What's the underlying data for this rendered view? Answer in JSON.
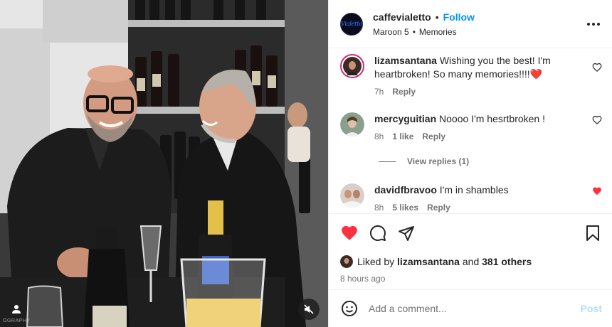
{
  "header": {
    "username": "caffevialetto",
    "separator": "•",
    "follow_label": "Follow",
    "audio_artist": "Maroon 5",
    "audio_separator": "•",
    "audio_track": "Memories",
    "logo_text": "Vialetto",
    "more_icon": "more-horizontal-icon"
  },
  "media": {
    "watermark": "OGRAPHY",
    "user_tag_icon": "user-tag-icon",
    "mute_icon": "speaker-muted-icon"
  },
  "comments": [
    {
      "username": "lizamsantana",
      "text": "Wishing you the best! I'm heartbroken! So many memories!!!!❤️",
      "time": "7h",
      "likes": "",
      "reply_label": "Reply",
      "liked": false
    },
    {
      "username": "mercyguitian",
      "text": "Noooo I'm hesrtbroken !",
      "time": "8h",
      "likes": "1 like",
      "reply_label": "Reply",
      "liked": false
    },
    {
      "username": "davidfbravoo",
      "text": "I'm in shambles",
      "time": "8h",
      "likes": "5 likes",
      "reply_label": "Reply",
      "liked": true
    }
  ],
  "view_replies_label": "View replies (1)",
  "likes": {
    "prefix": "Liked by",
    "user": "lizamsantana",
    "and": "and",
    "others": "381 others"
  },
  "time_ago": "8 hours ago",
  "add_comment": {
    "placeholder": "Add a comment...",
    "post_label": "Post"
  },
  "colors": {
    "accent": "#0095f6",
    "like_red": "#ff3040",
    "post_disabled": "#b2dffc"
  }
}
